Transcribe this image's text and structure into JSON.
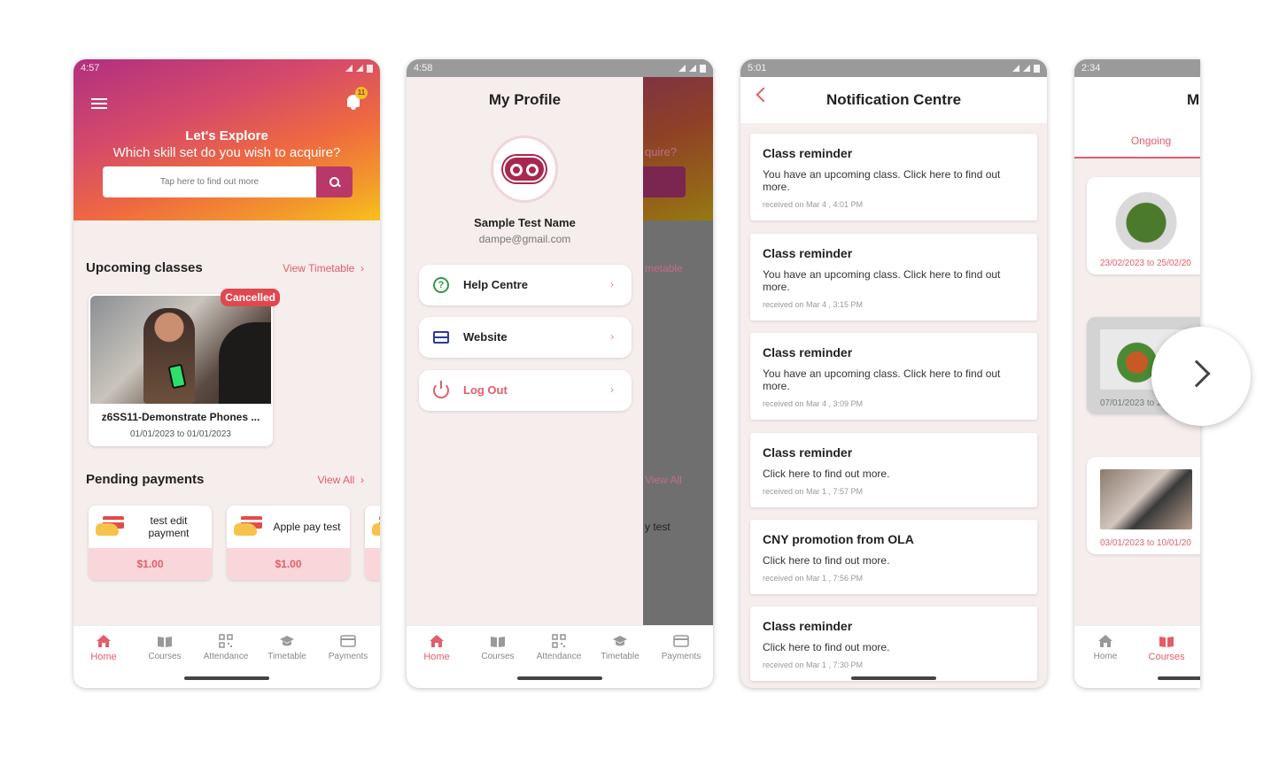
{
  "nav": {
    "home": "Home",
    "courses": "Courses",
    "attendance": "Attendance",
    "timetable": "Timetable",
    "payments": "Payments"
  },
  "screen1": {
    "status_time": "4:57",
    "badge_count": "11",
    "hero_title": "Let's Explore",
    "hero_subtitle": "Which skill set do you wish to acquire?",
    "search_placeholder": "Tap here to find out more",
    "upcoming_title": "Upcoming classes",
    "view_timetable": "View Timetable",
    "class_badge": "Cancelled",
    "class_name": "z6SS11-Demonstrate Phones ...",
    "class_date": "01/01/2023 to 01/01/2023",
    "pending_title": "Pending payments",
    "view_all": "View All",
    "payments": [
      {
        "label": "test edit payment",
        "amount": "$1.00"
      },
      {
        "label": "Apple pay test",
        "amount": "$1.00"
      }
    ]
  },
  "screen2": {
    "status_time": "4:58",
    "title": "My Profile",
    "name": "Sample Test Name",
    "email": "dampe@gmail.com",
    "menu": [
      {
        "label": "Help Centre"
      },
      {
        "label": "Website"
      },
      {
        "label": "Log Out"
      }
    ],
    "behind_text_1": "quire?",
    "behind_text_2": "metable",
    "behind_text_3": "View All",
    "behind_text_4": "y test"
  },
  "screen3": {
    "status_time": "5:01",
    "title": "Notification Centre",
    "notifications": [
      {
        "title": "Class reminder",
        "body": "You have an upcoming class. Click here to find out more.",
        "received": "received on Mar 4 , 4:01 PM"
      },
      {
        "title": "Class reminder",
        "body": "You have an upcoming class. Click here to find out more.",
        "received": "received on Mar 4 , 3:15 PM"
      },
      {
        "title": "Class reminder",
        "body": "You have an upcoming class. Click here to find out more.",
        "received": "received on Mar 4 , 3:09 PM"
      },
      {
        "title": "Class reminder",
        "body": "Click here to find out more.",
        "received": "received on Mar 1 , 7:57 PM"
      },
      {
        "title": "CNY promotion from OLA",
        "body": "Click here to find out more.",
        "received": "received on Mar 1 , 7:56 PM"
      },
      {
        "title": "Class reminder",
        "body": "Click here to find out more.",
        "received": "received on Mar 1 , 7:30 PM"
      }
    ]
  },
  "screen4": {
    "status_time": "2:34",
    "title": "M",
    "tab_ongoing": "Ongoing",
    "courses": [
      {
        "date": "23/02/2023 to 25/02/20"
      },
      {
        "date": "07/01/2023 to 28/"
      },
      {
        "date": "03/01/2023 to 10/01/20"
      }
    ]
  }
}
